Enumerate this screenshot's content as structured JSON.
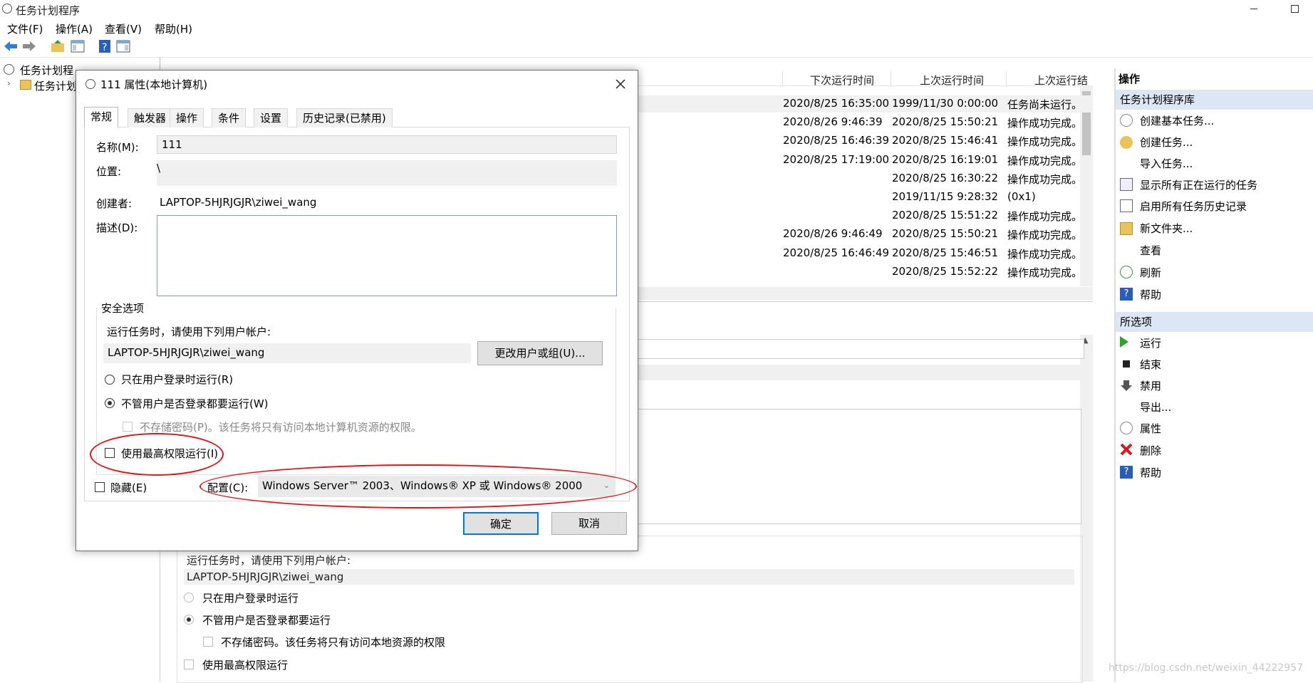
{
  "app": {
    "title": "任务计划程序",
    "menu": [
      "文件(F)",
      "操作(A)",
      "查看(V)",
      "帮助(H)"
    ]
  },
  "tree": {
    "root": "任务计划程",
    "child": "任务计划"
  },
  "task_list": {
    "columns": [
      "下次运行时间",
      "上次运行时间",
      "上次运行结"
    ],
    "rows": [
      {
        "next": "2020/8/25 16:35:00",
        "last": "1999/11/30 0:00:00",
        "result": "任务尚未运行。"
      },
      {
        "next": "2020/8/26 9:46:39",
        "last": "2020/8/25 15:50:21",
        "result": "操作成功完成。"
      },
      {
        "next": "2020/8/25 16:46:39",
        "last": "2020/8/25 15:46:41",
        "result": "操作成功完成。"
      },
      {
        "next": "2020/8/25 17:19:00",
        "last": "2020/8/25 16:19:01",
        "result": "操作成功完成。"
      },
      {
        "next": "",
        "last": "2020/8/25 16:30:22",
        "result": "操作成功完成。"
      },
      {
        "next": "",
        "last": "2019/11/15 9:28:32",
        "result": "(0x1)"
      },
      {
        "next": "",
        "last": "2020/8/25 15:51:22",
        "result": "操作成功完成。"
      },
      {
        "next": "2020/8/26 9:46:49",
        "last": "2020/8/25 15:50:21",
        "result": "操作成功完成。"
      },
      {
        "next": "2020/8/25 16:46:49",
        "last": "2020/8/25 15:46:51",
        "result": "操作成功完成。"
      },
      {
        "next": "",
        "last": "2020/8/25 15:52:22",
        "result": "操作成功完成。"
      }
    ]
  },
  "actions": {
    "header": "操作",
    "section1": "任务计划程序库",
    "items1": [
      "创建基本任务...",
      "创建任务...",
      "导入任务...",
      "显示所有正在运行的任务",
      "启用所有任务历史记录",
      "新文件夹...",
      "查看",
      "刷新",
      "帮助"
    ],
    "section2": "所选项",
    "items2": [
      "运行",
      "结束",
      "禁用",
      "导出...",
      "属性",
      "删除",
      "帮助"
    ]
  },
  "background_security": {
    "run_as_label": "运行任务时，请使用下列用户帐户:",
    "user": "LAPTOP-5HJRJGJR\\ziwei_wang",
    "opt_logged_on": "只在用户登录时运行",
    "opt_whether": "不管用户是否登录都要运行",
    "opt_no_password": "不存储密码。该任务将只有访问本地资源的权限",
    "opt_highest": "使用最高权限运行"
  },
  "dialog": {
    "title": "111 属性(本地计算机)",
    "tabs": [
      "常规",
      "触发器",
      "操作",
      "条件",
      "设置",
      "历史记录(已禁用)"
    ],
    "name_label": "名称(M):",
    "name_value": "111",
    "location_label": "位置:",
    "location_value": "\\",
    "author_label": "创建者:",
    "author_value": "LAPTOP-5HJRJGJR\\ziwei_wang",
    "desc_label": "描述(D):",
    "desc_value": "",
    "security_group": "安全选项",
    "run_as_label": "运行任务时，请使用下列用户帐户:",
    "run_as_user": "LAPTOP-5HJRJGJR\\ziwei_wang",
    "change_user_btn": "更改用户或组(U)...",
    "opt_logged_on": "只在用户登录时运行(R)",
    "opt_whether": "不管用户是否登录都要运行(W)",
    "opt_no_password": "不存储密码(P)。该任务将只有访问本地计算机资源的权限。",
    "opt_highest": "使用最高权限运行(I)",
    "hidden_label": "隐藏(E)",
    "config_label": "配置(C):",
    "config_value": "Windows Server™ 2003、Windows® XP 或 Windows® 2000",
    "ok_btn": "确定",
    "cancel_btn": "取消"
  },
  "watermark": "https://blog.csdn.net/weixin_44222957"
}
